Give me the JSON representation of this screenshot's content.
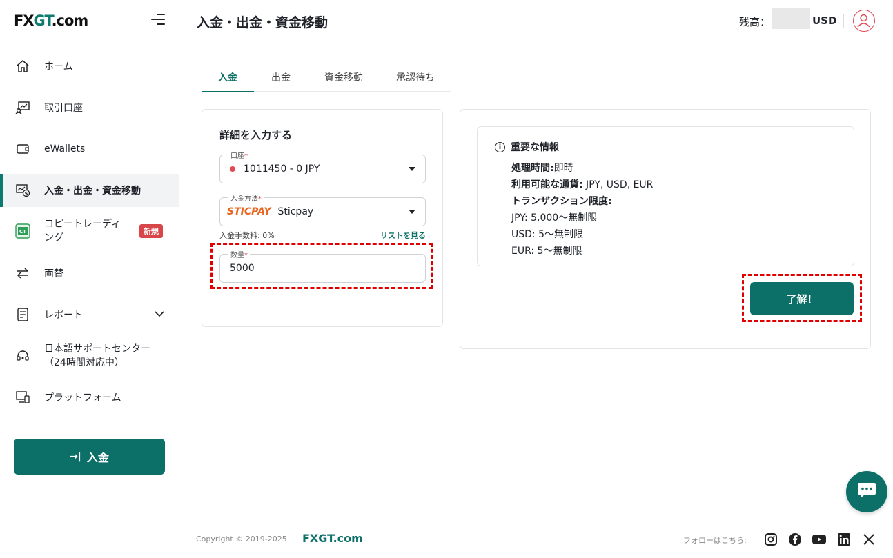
{
  "brand": {
    "logo": "FXGT.com"
  },
  "sidebar": {
    "items": [
      {
        "label": "ホーム",
        "icon": "home-icon"
      },
      {
        "label": "取引口座",
        "icon": "trading-account-icon"
      },
      {
        "label": "eWallets",
        "icon": "wallet-icon"
      },
      {
        "label": "入金・出金・資金移動",
        "icon": "deposit-withdraw-icon",
        "active": true
      },
      {
        "label": "コピートレーディング",
        "icon": "copy-trading-icon",
        "badge": "新規"
      },
      {
        "label": "両替",
        "icon": "exchange-icon"
      },
      {
        "label": "レポート",
        "icon": "report-icon"
      },
      {
        "label": "日本語サポートセンター（24時間対応中）",
        "icon": "support-headset-icon"
      },
      {
        "label": "プラットフォーム",
        "icon": "platform-icon"
      }
    ],
    "copy_line1": "コピートレーディ",
    "copy_line2": "ング",
    "support_line1": "日本語サポートセンター",
    "support_line2": "（24時間対応中）",
    "deposit_button": "入金"
  },
  "header": {
    "title": "入金・出金・資金移動",
    "balance_label": "残高：",
    "balance_currency": "USD"
  },
  "tabs": [
    "入金",
    "出金",
    "資金移動",
    "承認待ち"
  ],
  "form": {
    "title": "詳細を入力する",
    "account_label": "口座",
    "account_value": "1011450 - 0 JPY",
    "method_label": "入金方法",
    "method_logo": "STICPAY",
    "method_value": "Sticpay",
    "fee_text": "入金手数料: 0%",
    "fee_link": "リストを見る",
    "amount_label": "数量",
    "amount_value": "5000",
    "required_mark": "*"
  },
  "info": {
    "heading": "重要な情報",
    "processing_label": "処理時間:",
    "processing_value": "即時",
    "currencies_label": "利用可能な通貨:",
    "currencies_value": " JPY, USD, EUR",
    "limits_label": "トランザクション限度:",
    "limit_jpy": "JPY: 5,000〜無制限",
    "limit_usd": "USD: 5〜無制限",
    "limit_eur": "EUR: 5〜無制限",
    "ok_button": "了解！"
  },
  "footer": {
    "copyright": "Copyright © 2019-2025",
    "brand": "FXGT.com",
    "follow": "フォローはこちら:",
    "socials": [
      "instagram-icon",
      "facebook-icon",
      "youtube-icon",
      "linkedin-icon",
      "x-icon"
    ]
  },
  "colors": {
    "accent": "#0d7068",
    "badge": "#d9464a",
    "highlight": "#e00000"
  }
}
